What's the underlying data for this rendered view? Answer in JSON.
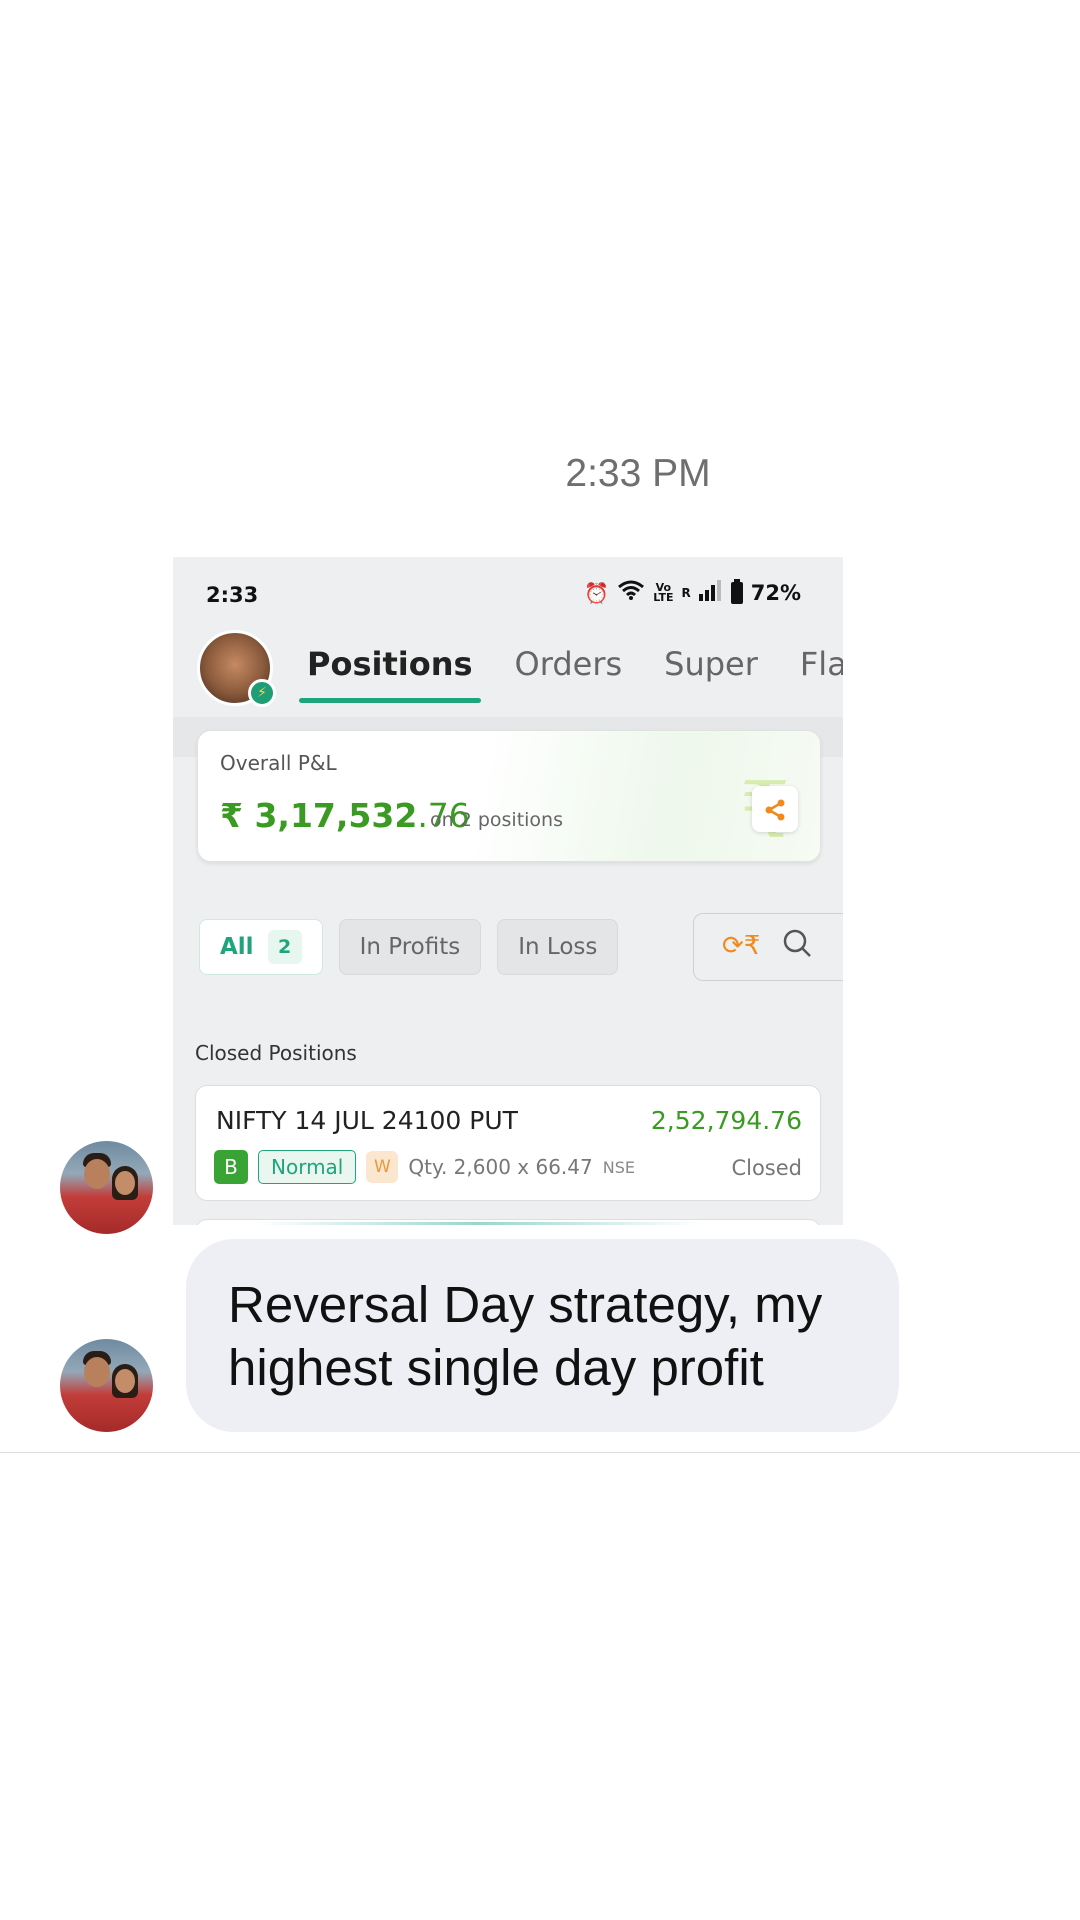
{
  "chat": {
    "timestamp": "2:33 PM",
    "message": "Reversal Day strategy, my highest single day profit"
  },
  "screenshot": {
    "status_bar": {
      "time": "2:33",
      "volte": "Vo\nLTE",
      "roaming": "R",
      "battery": "72%"
    },
    "tabs": [
      "Positions",
      "Orders",
      "Super",
      "Flash"
    ],
    "active_tab": "Positions",
    "pnl": {
      "label": "Overall P&L",
      "currency": "₹",
      "value_main": "3,17,532",
      "value_decimal": ".76",
      "sub": "on 2 positions"
    },
    "filters": {
      "all_label": "All",
      "all_count": "2",
      "profits_label": "In Profits",
      "loss_label": "In Loss"
    },
    "section_title": "Closed Positions",
    "position": {
      "name": "NIFTY 14 JUL 24100 PUT",
      "pnl": "2,52,794.76",
      "side": "B",
      "product": "Normal",
      "validity": "W",
      "qty": "Qty. 2,600 x 66.47",
      "exchange": "NSE",
      "status": "Closed"
    }
  },
  "icons": {
    "alarm": "alarm-icon",
    "wifi": "wifi-icon",
    "signal": "signal-icon",
    "share": "share-icon",
    "rupee_refresh": "rupee-refresh-icon",
    "search": "search-icon",
    "bolt": "bolt-icon"
  },
  "colors": {
    "profit_green": "#3a9a22",
    "accent_teal": "#1fa57c",
    "bubble_bg": "#eeeff5",
    "orange": "#f08a1c"
  }
}
